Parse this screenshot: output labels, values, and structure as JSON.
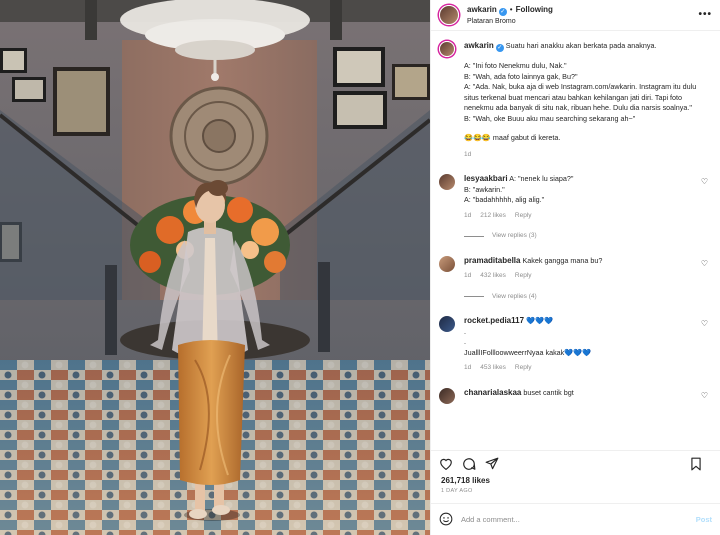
{
  "post": {
    "username": "awkarin",
    "follow_label": "Following",
    "separator": "•",
    "location": "Plataran Bromo"
  },
  "caption": {
    "username": "awkarin",
    "line1": "Suatu hari anakku akan berkata pada anaknya.",
    "line2": "A: \"Ini foto Nenekmu dulu, Nak.\"",
    "line3": "B: \"Wah, ada foto lainnya gak, Bu?\"",
    "line4": "A: \"Ada. Nak, buka aja di web Instagram.com/awkarin. Instagram itu dulu situs terkenal buat mencari atau bahkan kehilangan jati diri. Tapi foto nenekmu ada banyak di situ nak, ribuan hehe. Dulu dia narsis soalnya.\"",
    "line5": "B: \"Wah, oke Buuu aku mau searching sekarang ah~\"",
    "emoji": "😂😂😂",
    "line6": " maaf gabut di kereta.",
    "time": "1d"
  },
  "comments": [
    {
      "username": "lesyaakbari",
      "text1": " A: \"nenek lu siapa?\"",
      "text2": "B: \"awkarin.\"",
      "text3": "A: \"badahhhhh, alig alig.\"",
      "time": "1d",
      "likes": "212 likes",
      "reply": "Reply",
      "view_replies": "View replies (3)"
    },
    {
      "username": "pramaditabella",
      "text1": " Kakek gangga mana bu?",
      "time": "1d",
      "likes": "432 likes",
      "reply": "Reply",
      "view_replies": "View replies (4)"
    },
    {
      "username": "rocket.pedia117",
      "text1": " 💙💙💙",
      "text2": ".",
      "text3": ".",
      "text4": "JualllIFollloowweerrNyaa kakak",
      "text4_emoji": "💙💙💙",
      "time": "1d",
      "likes": "453 likes",
      "reply": "Reply"
    },
    {
      "username": "chanarialaskaa",
      "text1": " buset cantik bgt"
    }
  ],
  "footer": {
    "likes": "261,718 likes",
    "ago": "1 DAY AGO",
    "placeholder": "Add a comment...",
    "post_label": "Post"
  },
  "icons": {
    "like": "heart-icon",
    "comment": "comment-icon",
    "share": "share-icon",
    "save": "bookmark-icon",
    "emoji": "smiley-icon",
    "more": "more-icon"
  },
  "colors": {
    "verified": "#3897f0",
    "post_disabled": "#b2dffc",
    "muted": "#8e8e8e",
    "text": "#262626"
  }
}
